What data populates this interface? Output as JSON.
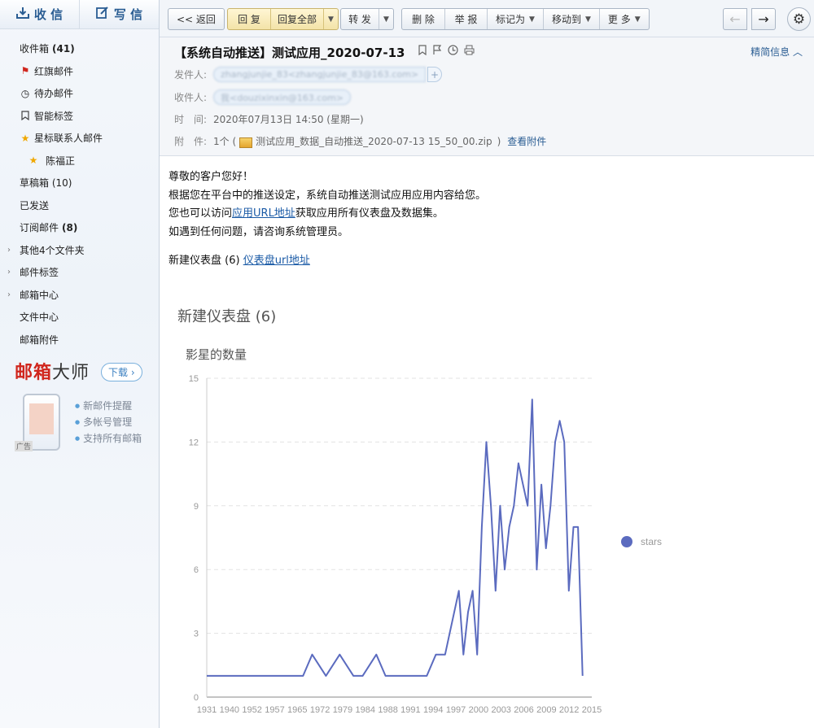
{
  "sidebar": {
    "receive_label": "收 信",
    "compose_label": "写 信",
    "folders": [
      {
        "label": "收件箱",
        "count": "(41)"
      },
      {
        "label": "红旗邮件"
      },
      {
        "label": "待办邮件"
      },
      {
        "label": "智能标签"
      },
      {
        "label": "星标联系人邮件"
      },
      {
        "label": "陈福正"
      },
      {
        "label": "草稿箱 (10)"
      },
      {
        "label": "已发送"
      },
      {
        "label": "订阅邮件",
        "count": "(8)"
      },
      {
        "label": "其他4个文件夹"
      },
      {
        "label": "邮件标签"
      },
      {
        "label": "邮箱中心"
      },
      {
        "label": "文件中心"
      },
      {
        "label": "邮箱附件"
      }
    ],
    "ad": {
      "title_red": "邮箱",
      "title_dark": "大师",
      "download": "下载",
      "features": [
        "新邮件提醒",
        "多帐号管理",
        "支持所有邮箱"
      ],
      "tag": "广告"
    }
  },
  "toolbar": {
    "back": "<< 返回",
    "reply": "回 复",
    "reply_all": "回复全部",
    "forward": "转 发",
    "delete": "删 除",
    "report": "举 报",
    "mark_as": "标记为",
    "move_to": "移动到",
    "more": "更 多"
  },
  "mail": {
    "subject": "【系统自动推送】测试应用_2020-07-13",
    "brief_info": "精简信息",
    "from_label": "发件人:",
    "from_value": "zhangjunjie_83<zhangjunjie_83@163.com>",
    "to_label": "收件人:",
    "to_value": "我<douzixinxin@163.com>",
    "time_label": "时　间:",
    "time_value": "2020年07月13日 14:50 (星期一)",
    "attach_label": "附　件:",
    "attach_count": "1个 (",
    "attach_name": "测试应用_数据_自动推送_2020-07-13 15_50_00.zip",
    "attach_close": ")",
    "view_attach": "查看附件"
  },
  "body": {
    "greeting": "尊敬的客户您好！",
    "line1": "根据您在平台中的推送设定，系统自动推送测试应用应用内容给您。",
    "line2_pre": "您也可以访问",
    "line2_link": "应用URL地址",
    "line2_post": "获取应用所有仪表盘及数据集。",
    "line3": "如遇到任何问题，请咨询系统管理员。",
    "dash_label": "新建仪表盘 (6)",
    "dash_link": "仪表盘url地址",
    "dash_title": "新建仪表盘 (6)"
  },
  "chart_data": {
    "type": "line",
    "title": "影星的数量",
    "x": [
      1931,
      1935,
      1940,
      1944,
      1948,
      1952,
      1954,
      1957,
      1960,
      1963,
      1965,
      1968,
      1970,
      1972,
      1975,
      1977,
      1979,
      1981,
      1983,
      1984,
      1986,
      1987,
      1988,
      1989,
      1990,
      1991,
      1992,
      1993,
      1994,
      1995,
      1996,
      1997,
      1998,
      1999,
      2000,
      2001,
      2002,
      2003,
      2004,
      2005,
      2006,
      2007,
      2008,
      2009,
      2010,
      2011,
      2012,
      2013,
      2014,
      2015
    ],
    "tick_labels": [
      "1931",
      "1940",
      "1952",
      "1957",
      "1965",
      "1972",
      "1979",
      "1984",
      "1988",
      "1991",
      "1994",
      "1997",
      "2000",
      "2003",
      "2006",
      "2009",
      "2012",
      "2015"
    ],
    "series": [
      {
        "name": "stars",
        "color": "#5b6bbf",
        "values": [
          1,
          1,
          1,
          1,
          1,
          1,
          2,
          1,
          2,
          1,
          1,
          2,
          1,
          1,
          1,
          1,
          1,
          2,
          2,
          3,
          5,
          2,
          4,
          5,
          2,
          8,
          12,
          9,
          5,
          9,
          6,
          8,
          9,
          11,
          10,
          9,
          14,
          6,
          10,
          7,
          9,
          12,
          13,
          12,
          5,
          8,
          8,
          1
        ]
      }
    ],
    "ylim": [
      0,
      15
    ],
    "yticks": [
      0,
      3,
      6,
      9,
      12,
      15
    ],
    "grid": true,
    "legend": "right"
  }
}
